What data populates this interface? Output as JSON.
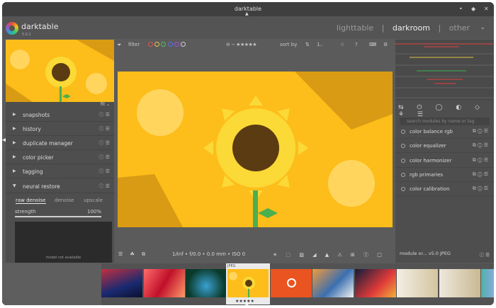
{
  "window": {
    "title": "darktable",
    "minimize": "•",
    "maximize": "◆",
    "close": "✕"
  },
  "header": {
    "app_name": "darktable",
    "app_version": "5.0.1",
    "views": {
      "lighttable": "lighttable",
      "darkroom": "darkroom",
      "other": "other",
      "sep": "|"
    },
    "active_view": "darkroom",
    "collapse_icon": "chevron-down-icon"
  },
  "left_panel": {
    "fit_label": "fit",
    "modules": [
      {
        "label": "snapshots",
        "expanded": false
      },
      {
        "label": "history",
        "expanded": false
      },
      {
        "label": "duplicate manager",
        "expanded": false
      },
      {
        "label": "color picker",
        "expanded": false
      },
      {
        "label": "tagging",
        "expanded": false
      },
      {
        "label": "neural restore",
        "expanded": true
      }
    ],
    "collapsed_arrow": "▶",
    "expanded_arrow": "▼",
    "module_icons": "ⓘ ☰",
    "neural_restore": {
      "tabs": [
        "raw denoise",
        "denoise",
        "upscale"
      ],
      "active_tab": "raw denoise",
      "strength_label": "strength",
      "strength_value": "100%",
      "strength_fraction": 1.0,
      "preview_text": "model not available"
    }
  },
  "top_toolbar": {
    "filter_label": "filter",
    "sort_label": "sort by",
    "sort_value": "1..",
    "color_label_colors": [
      "#e05252",
      "#e0c452",
      "#52c452",
      "#5278e0",
      "#a052e0",
      "#cfcfcf"
    ],
    "star_rating": "⊖ − ★★★★★"
  },
  "bottom_toolbar": {
    "exif": "1/inf • f/0.0 • 0.0 mm • ISO 0",
    "left_icons": "☰ ☘ ⧉",
    "right_icons": "☀ ⬚ ▨ ◢ ▲ ⚠ ⊞ Ⓘ □"
  },
  "right_panel": {
    "group_icons": "⇆ ⏻ ◯ ◐ ◇ ⚘ ☰",
    "search_placeholder": "search modules by name or tag",
    "modules": [
      {
        "label": "color balance rgb"
      },
      {
        "label": "color equalizer"
      },
      {
        "label": "color harmonizer"
      },
      {
        "label": "rgb primaries"
      },
      {
        "label": "color calibration"
      }
    ],
    "module_icons": "⧉ ⓘ ☰",
    "status_text": "module or... v5.0 JPEG",
    "status_icons": "ⓘ ☰"
  },
  "filmstrip": {
    "selected_index": 3,
    "selected_format": "JPEG",
    "selected_stars": "★★★★★"
  },
  "colors": {
    "sunflower_bg": "#fdbd1a",
    "petals": "#fbd936",
    "center": "#5a3b12",
    "stem": "#4caf50",
    "triangle": "#d99b14",
    "circle": "#ffd55e"
  }
}
